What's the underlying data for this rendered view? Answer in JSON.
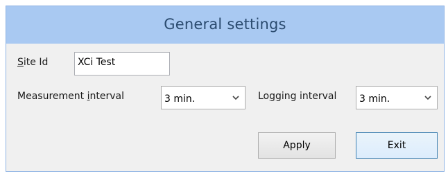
{
  "window": {
    "title": "General settings"
  },
  "form": {
    "site_id": {
      "label_prefix": "",
      "label_mnemonic": "S",
      "label_rest": "ite Id",
      "value": "XCi Test"
    },
    "measurement_interval": {
      "label_before": "Measurement ",
      "label_mnemonic": "i",
      "label_after": "nterval",
      "selected": "3 min."
    },
    "logging_interval": {
      "label_before": "Lo",
      "label_mnemonic": "g",
      "label_after": "ging interval",
      "selected": "3 min."
    }
  },
  "buttons": {
    "apply": "Apply",
    "exit": "Exit"
  },
  "icons": {
    "dropdown": "chevron-down-icon"
  },
  "colors": {
    "titlebar": "#a9c9f2",
    "title_text": "#2b4b6f",
    "body": "#f0f0f0",
    "focus_border": "#3c7fb1"
  }
}
